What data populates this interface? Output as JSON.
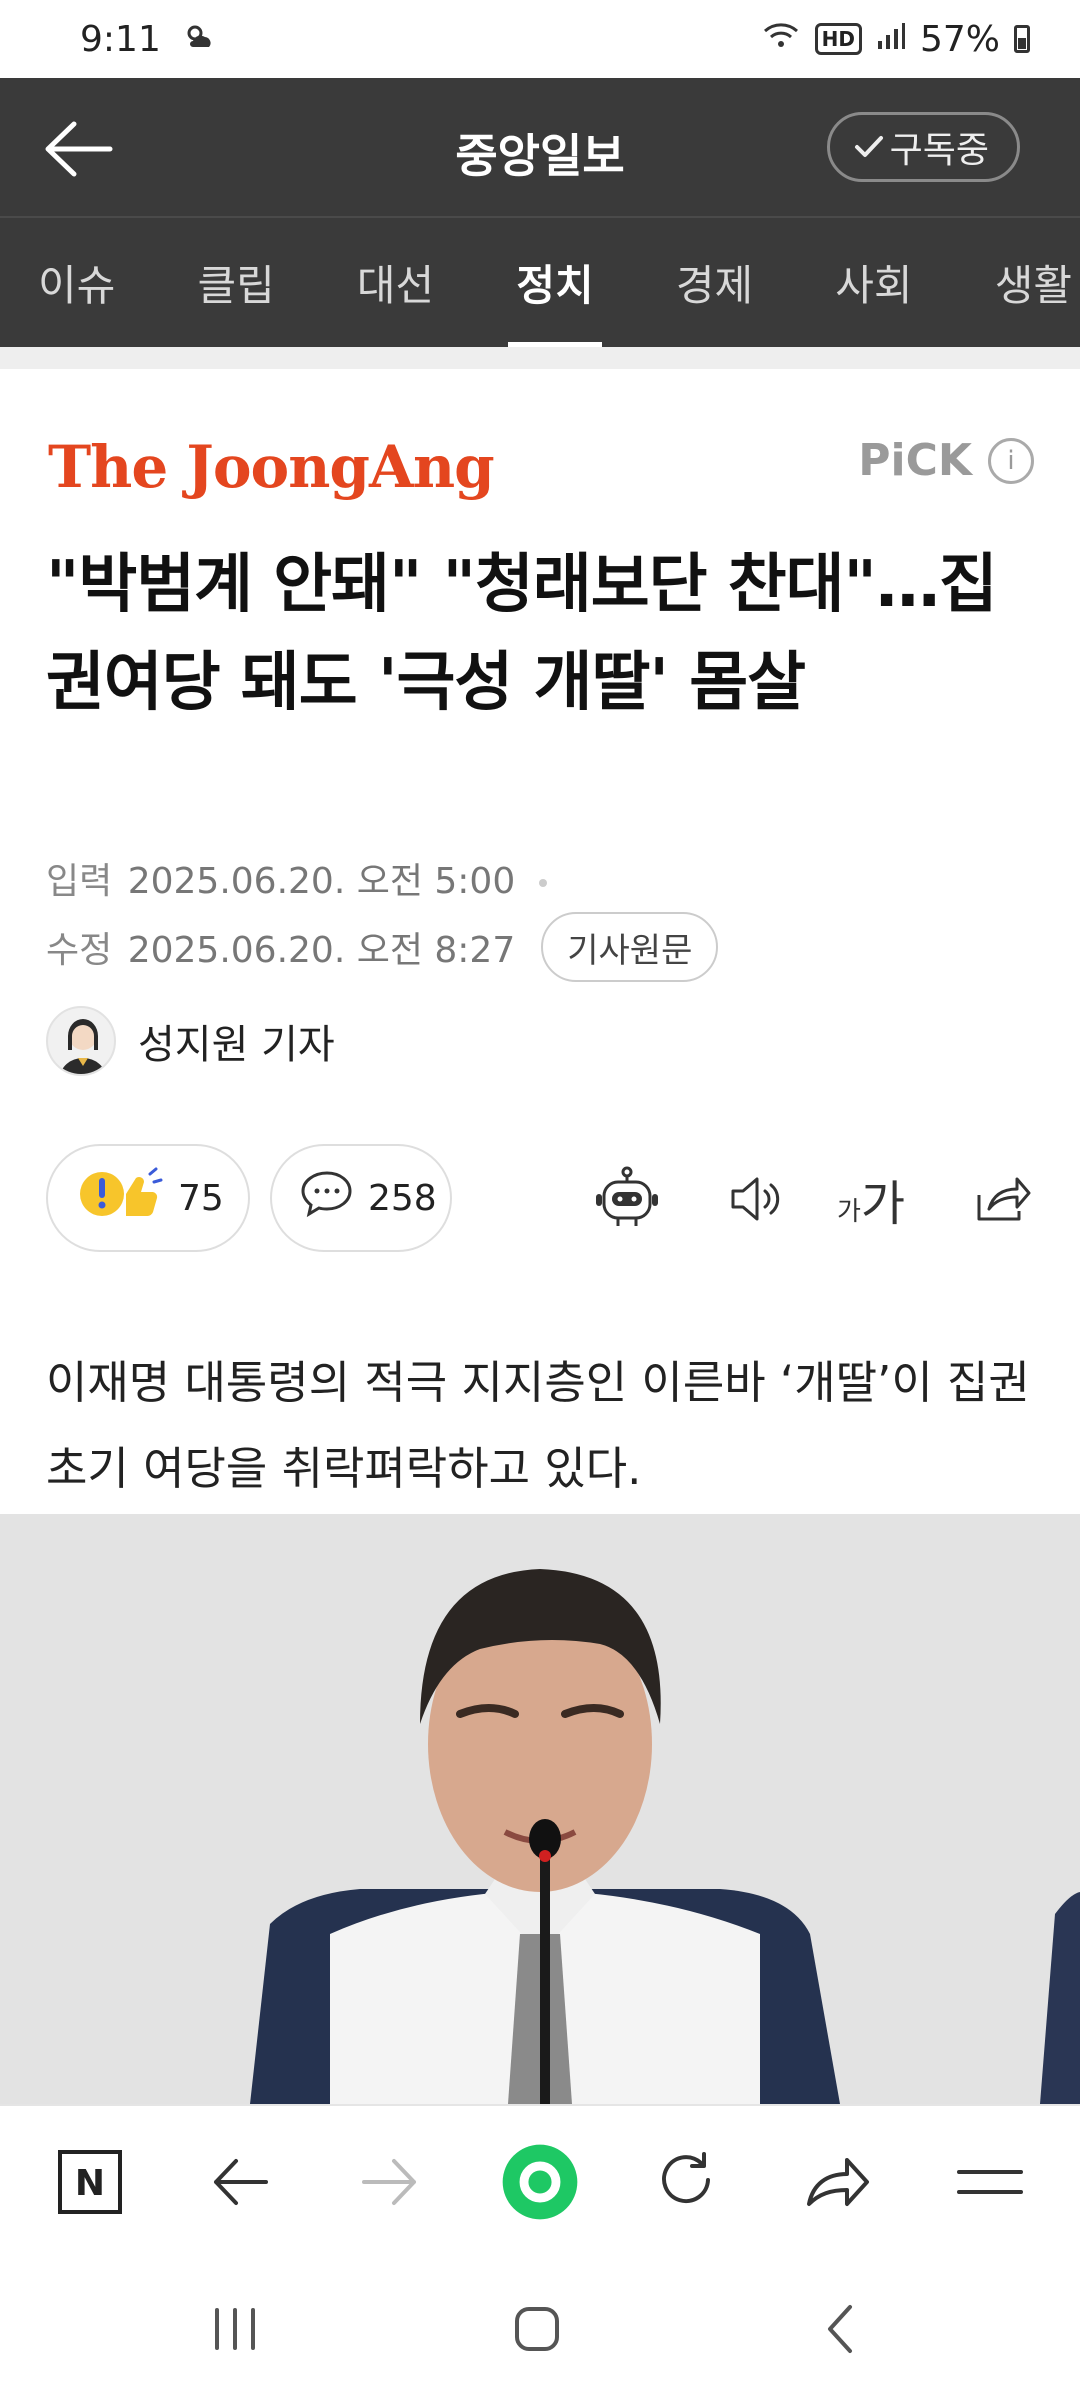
{
  "status_bar": {
    "time": "9:11",
    "hd_label": "HD",
    "battery": "57%"
  },
  "app_bar": {
    "title": "중앙일보",
    "subscribe_label": "구독중"
  },
  "tabs": [
    "이슈",
    "클립",
    "대선",
    "정치",
    "경제",
    "사회",
    "생활"
  ],
  "active_tab": "정치",
  "article": {
    "publisher_logo": "The JoongAng",
    "pick_label": "PiCK",
    "pick_info": "i",
    "headline": "\"박범계 안돼\" \"청래보단 찬대\"…집권여당 돼도 '극성 개딸' 몸살",
    "input_label": "입력",
    "input_time": "2025.06.20. 오전 5:00",
    "edit_label": "수정",
    "edit_time": "2025.06.20. 오전 8:27",
    "source_button": "기사원문",
    "reporter": "성지원 기자",
    "reaction_count": "75",
    "comment_count": "258",
    "font_size_small": "가",
    "font_size_large": "가",
    "lead": "이재명 대통령의 적극 지지층인 이른바 ‘개딸’이 집권 초기 여당을 취락펴락하고 있다."
  },
  "browser_bar": {
    "home_letter": "N"
  },
  "colors": {
    "header_bg": "#3a3a3a",
    "logo_red": "#e4461f",
    "green_accent": "#1ec864"
  }
}
